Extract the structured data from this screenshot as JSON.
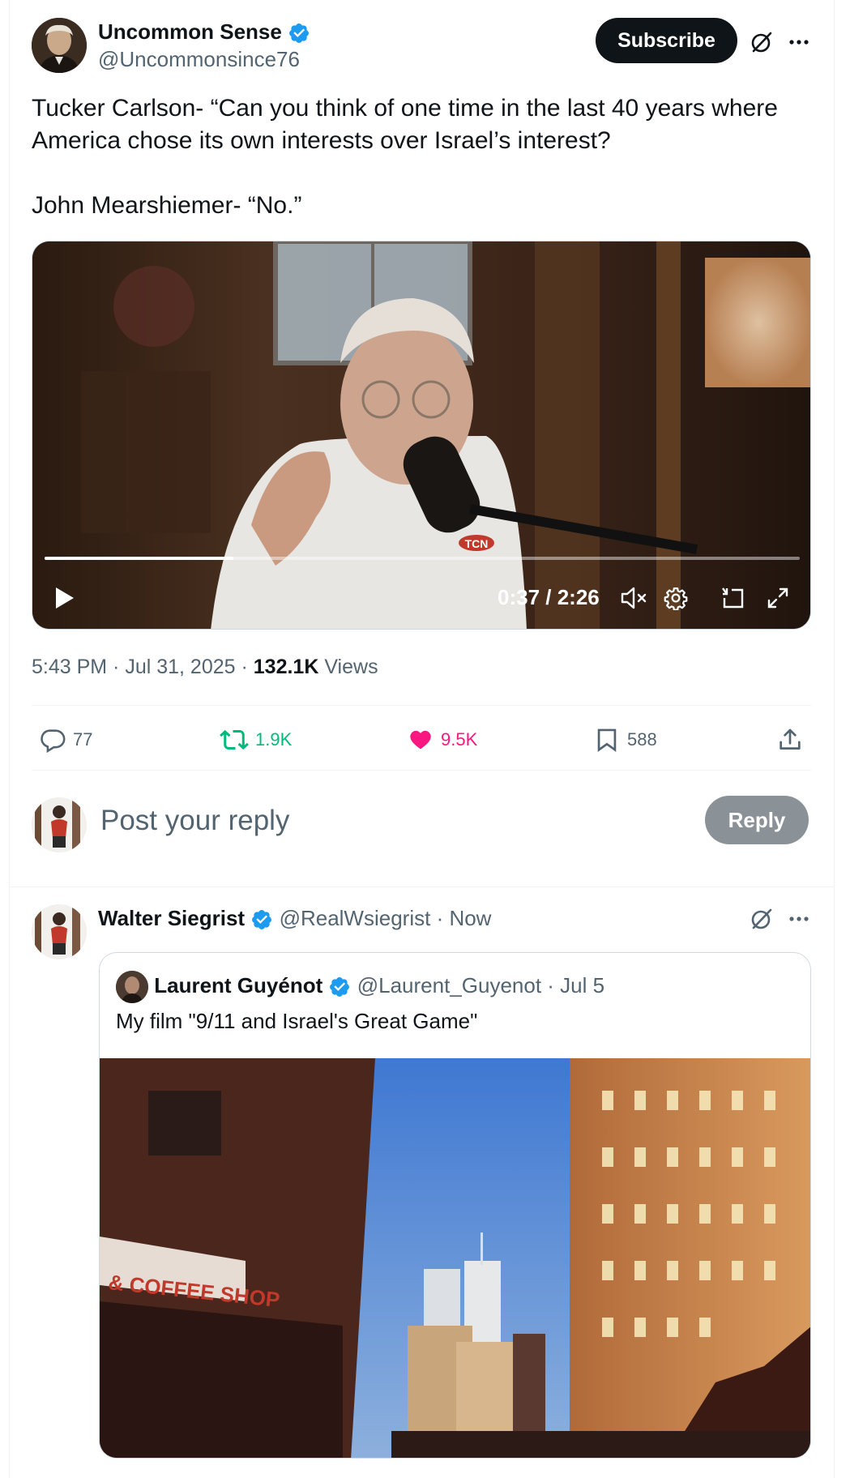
{
  "tweet": {
    "author_name": "Uncommon Sense",
    "author_handle": "@Uncommonsince76",
    "subscribe_label": "Subscribe",
    "text_lines": [
      "Tucker Carlson- “Can you think of one time in the last 40 years where",
      "America chose its own interests over Israel’s interest?",
      "John Mearshiemer- “No.”"
    ],
    "video": {
      "time": "0:37 / 2:26",
      "progress": 0.25,
      "mic_label": "TCN"
    },
    "timestamp": "5:43 PM · Jul 31, 2025 · ",
    "views_count": "132.1K",
    "views_label": " Views",
    "actions": {
      "replies": "77",
      "reposts": "1.9K",
      "likes": "9.5K",
      "bookmarks": "588"
    }
  },
  "reply_box": {
    "placeholder": "Post your reply",
    "reply_label": "Reply"
  },
  "reply_tweet": {
    "author_name": "Walter Siegrist",
    "author_handle": "@RealWsiegrist",
    "time": "· Now",
    "quote": {
      "author_name": "Laurent Guyénot",
      "author_handle": "@Laurent_Guyenot",
      "date": "· Jul 5",
      "text": "My film \"9/11 and Israel's Great Game\"",
      "image_sign": "& COFFEE SHOP"
    }
  },
  "colors": {
    "brand_blue": "#1d9bf0",
    "repost_green": "#00ba7c",
    "like_pink": "#f91880",
    "muted": "#536471",
    "text": "#0f1419"
  },
  "icons": [
    "grok-icon",
    "more-icon",
    "verified-icon",
    "play-icon",
    "mute-icon",
    "settings-icon",
    "minimize-icon",
    "fullscreen-icon",
    "reply-icon",
    "repost-icon",
    "like-icon",
    "bookmark-icon",
    "share-icon"
  ]
}
